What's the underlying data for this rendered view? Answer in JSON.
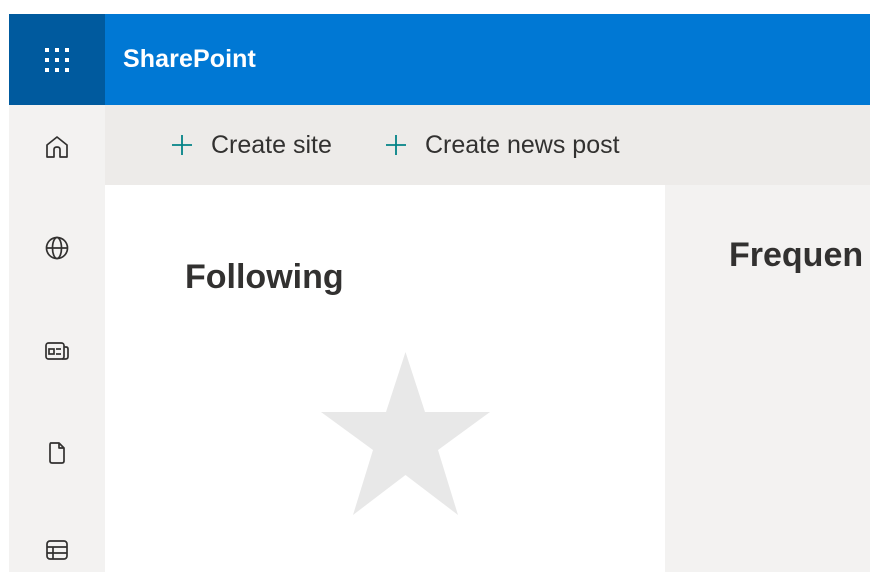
{
  "suitebar": {
    "app_name": "SharePoint",
    "waffle_icon": "app-launcher-icon",
    "color": "#0078d4",
    "waffle_color": "#005a9e"
  },
  "left_rail": {
    "items": [
      {
        "name": "home",
        "icon": "home-icon"
      },
      {
        "name": "sites",
        "icon": "globe-icon"
      },
      {
        "name": "news",
        "icon": "news-icon"
      },
      {
        "name": "files",
        "icon": "document-icon"
      },
      {
        "name": "lists",
        "icon": "list-icon"
      }
    ]
  },
  "commands": {
    "create_site": "Create site",
    "create_news_post": "Create news post",
    "accent_color": "#038387"
  },
  "following": {
    "title": "Following",
    "empty_icon": "star-icon"
  },
  "frequent": {
    "title": "Frequen"
  }
}
